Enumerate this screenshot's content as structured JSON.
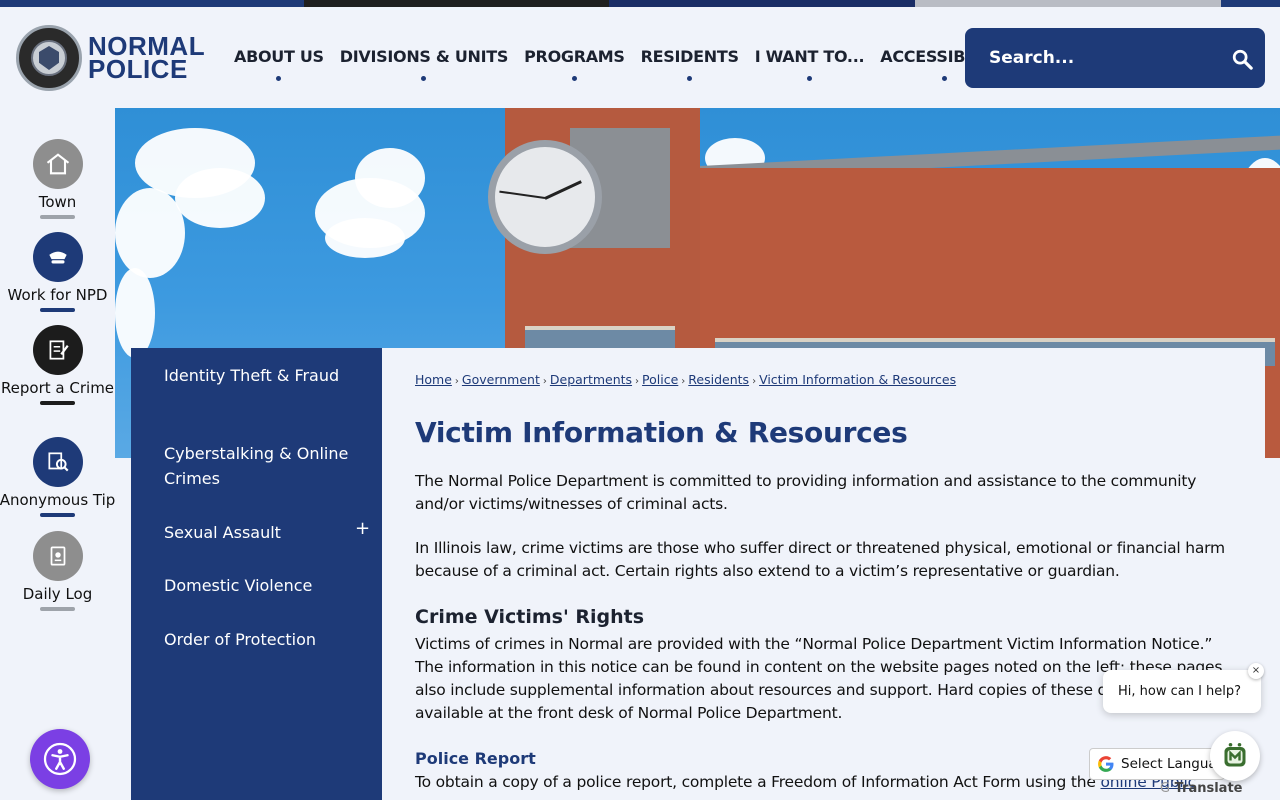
{
  "colors": {
    "brand_navy": "#1e3a78",
    "strip": [
      "#1e3a78",
      "#1f1f1f",
      "#1a2d66",
      "#b9bcc4",
      "#1e3a78"
    ],
    "accessibility_purple": "#7b3fe4"
  },
  "header": {
    "logo_line1": "NORMAL",
    "logo_line2": "POLICE",
    "nav": [
      "ABOUT US",
      "DIVISIONS & UNITS",
      "PROGRAMS",
      "RESIDENTS",
      "I WANT TO...",
      "ACCESSIBILITY"
    ],
    "search_placeholder": "Search..."
  },
  "quick_links": [
    {
      "label": "Town",
      "icon": "home-icon"
    },
    {
      "label": "Work for NPD",
      "icon": "police-hat-icon"
    },
    {
      "label": "Report a Crime",
      "icon": "report-icon"
    },
    {
      "label": "Anonymous Tip",
      "icon": "tip-search-icon"
    },
    {
      "label": "Daily Log",
      "icon": "log-book-icon"
    }
  ],
  "sidenav": {
    "items": [
      "Identity Theft & Fraud",
      "Cyberstalking & Online Crimes",
      "Sexual Assault",
      "Domestic Violence",
      "Order of Protection"
    ],
    "expand_symbol": "+"
  },
  "breadcrumbs": [
    "Home",
    "Government",
    "Departments",
    "Police",
    "Residents",
    "Victim Information & Resources"
  ],
  "breadcrumb_separator": "›",
  "content": {
    "title": "Victim Information & Resources",
    "p1": "The Normal Police Department is committed to providing information and assistance to the community and/or victims/witnesses of criminal acts.",
    "p2": "In Illinois law, crime victims are those who suffer direct or threatened physical, emotional or financial harm because of a criminal act. Certain rights also extend to a victim’s representative or guardian.",
    "h_rights": "Crime Victims' Rights",
    "p3": "Victims of crimes in Normal are provided with the “Normal Police Department Victim Information Notice.” The information in this notice can be found in content on the website pages noted on the left; these pages also include supplemental information about resources and support. Hard copies of these documents are available at the front desk of Normal Police Department.",
    "h_report": "Police Report",
    "p4_prefix": "To obtain a copy of a police report, complete a Freedom of Information Act Form using the ",
    "p4_link": "online Public"
  },
  "widgets": {
    "chat_greeting": "Hi, how can I help?",
    "chat_close": "×",
    "translate_label": "Select Language",
    "translate_powered": "Translate"
  }
}
